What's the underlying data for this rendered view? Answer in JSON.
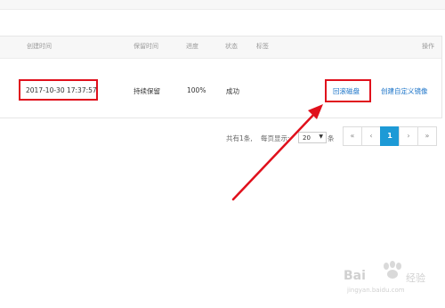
{
  "table": {
    "headers": {
      "created_time": "创建时间",
      "retention": "保留时间",
      "progress": "进度",
      "status": "状态",
      "tags": "标签",
      "actions": "操作"
    },
    "rows": [
      {
        "created_time": "2017-10-30 17:37:57",
        "retention": "持续保留",
        "progress": "100%",
        "status": "成功",
        "action_rollback": "回滚磁盘",
        "action_create_image": "创建自定义镜像"
      }
    ]
  },
  "pagination": {
    "total_text": "共有1条,",
    "per_page_label": "每页显示:",
    "per_page_value": "20",
    "per_page_unit": "条",
    "first": "«",
    "prev": "‹",
    "current": "1",
    "next": "›",
    "last": "»"
  },
  "watermark": {
    "brand": "Bai",
    "brand_suffix": "经验",
    "url": "jingyan.baidu.com"
  },
  "colors": {
    "annotation_red": "#e0101c",
    "link_blue": "#1a73c8",
    "page_active": "#1d9ad6"
  }
}
